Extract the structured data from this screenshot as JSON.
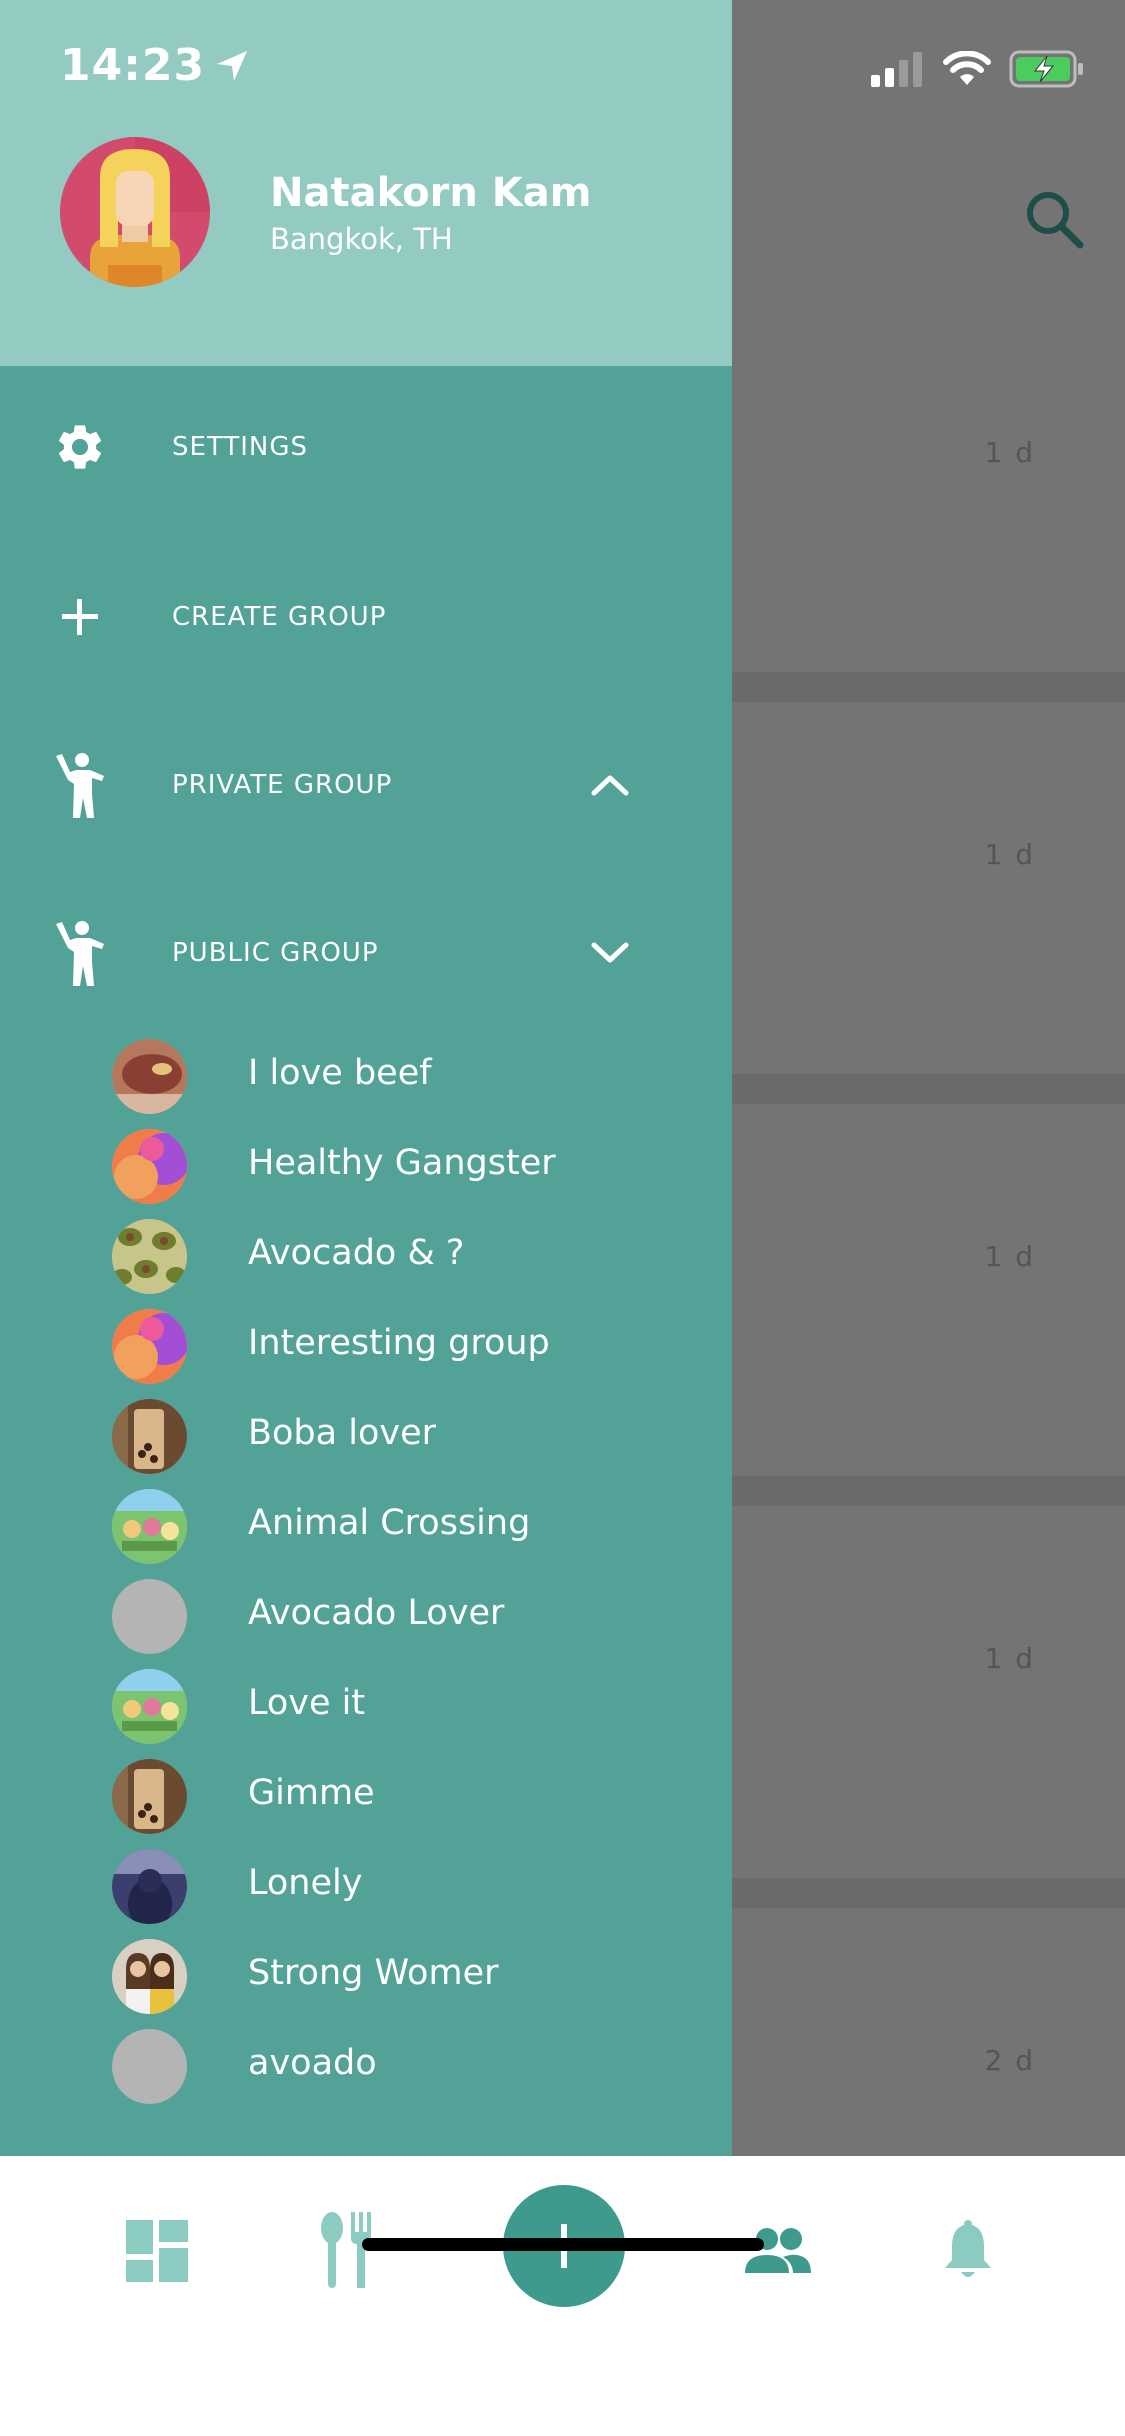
{
  "status_bar": {
    "time": "14:23"
  },
  "profile": {
    "name": "Natakorn Kam",
    "location": "Bangkok, TH"
  },
  "menu": {
    "settings": "SETTINGS",
    "create_group": "CREATE GROUP",
    "private_group": "PRIVATE GROUP",
    "public_group": "PUBLIC GROUP"
  },
  "groups": [
    {
      "label": "I love beef",
      "avatar": "beef"
    },
    {
      "label": "Healthy Gangster",
      "avatar": "watercolor"
    },
    {
      "label": "Avocado & ?",
      "avatar": "avocado"
    },
    {
      "label": "Interesting group",
      "avatar": "watercolor"
    },
    {
      "label": "Boba lover",
      "avatar": "boba"
    },
    {
      "label": "Animal Crossing",
      "avatar": "animal-crossing"
    },
    {
      "label": "Avocado Lover",
      "avatar": "placeholder"
    },
    {
      "label": "Love it",
      "avatar": "animal-crossing"
    },
    {
      "label": "Gimme",
      "avatar": "boba"
    },
    {
      "label": "Lonely",
      "avatar": "lonely"
    },
    {
      "label": "Strong Womer",
      "avatar": "women"
    },
    {
      "label": "avoado",
      "avatar": "placeholder"
    }
  ],
  "background_feed": {
    "times": [
      "1 d",
      "1 d",
      "1 d",
      "1 d",
      "2 d"
    ]
  },
  "colors": {
    "drawer": "#52a297",
    "drawer_header": "#93cac2",
    "accent": "#3f9a8e",
    "nav_icon": "#8ccbc2"
  },
  "bottom_nav": {
    "items": [
      "dashboard-icon",
      "food-icon",
      "add-icon",
      "people-icon",
      "bell-icon"
    ]
  }
}
